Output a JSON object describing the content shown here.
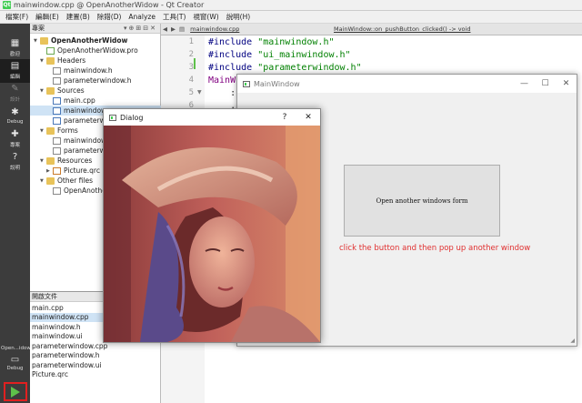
{
  "window": {
    "title": "mainwindow.cpp @ OpenAnotherWidow - Qt Creator"
  },
  "menu": [
    "檔案(F)",
    "編輯(E)",
    "建置(B)",
    "除錯(D)",
    "Analyze",
    "工具(T)",
    "視窗(W)",
    "說明(H)"
  ],
  "modes": [
    {
      "label": "歡迎",
      "icon": "grid-icon"
    },
    {
      "label": "編輯",
      "icon": "edit-icon"
    },
    {
      "label": "設計",
      "icon": "design-icon"
    },
    {
      "label": "Debug",
      "icon": "debug-icon"
    },
    {
      "label": "專案",
      "icon": "wrench-icon"
    },
    {
      "label": "說明",
      "icon": "help-icon"
    }
  ],
  "kit": {
    "name": "Open...idow",
    "mode": "Debug"
  },
  "project_panel": {
    "title": "專案",
    "tree": [
      {
        "label": "OpenAnotherWidow",
        "level": 0,
        "kind": "project"
      },
      {
        "label": "OpenAnotherWidow.pro",
        "level": 1,
        "kind": "proj"
      },
      {
        "label": "Headers",
        "level": 1,
        "kind": "folder"
      },
      {
        "label": "mainwindow.h",
        "level": 2,
        "kind": "file"
      },
      {
        "label": "parameterwindow.h",
        "level": 2,
        "kind": "file"
      },
      {
        "label": "Sources",
        "level": 1,
        "kind": "folder"
      },
      {
        "label": "main.cpp",
        "level": 2,
        "kind": "cpp"
      },
      {
        "label": "mainwindow.cpp",
        "level": 2,
        "kind": "cpp"
      },
      {
        "label": "parameterwindow.cpp",
        "level": 2,
        "kind": "cpp"
      },
      {
        "label": "Forms",
        "level": 1,
        "kind": "folder"
      },
      {
        "label": "mainwindow.ui",
        "level": 2,
        "kind": "file"
      },
      {
        "label": "parameterwindow.ui",
        "level": 2,
        "kind": "file"
      },
      {
        "label": "Resources",
        "level": 1,
        "kind": "folder"
      },
      {
        "label": "Picture.qrc",
        "level": 2,
        "kind": "res"
      },
      {
        "label": "Other files",
        "level": 1,
        "kind": "folder"
      },
      {
        "label": "OpenAnotherWidow",
        "level": 2,
        "kind": "file"
      }
    ]
  },
  "open_docs": {
    "title": "開啟文件",
    "items": [
      "main.cpp",
      "mainwindow.cpp",
      "mainwindow.h",
      "mainwindow.ui",
      "parameterwindow.cpp",
      "parameterwindow.h",
      "parameterwindow.ui",
      "Picture.qrc"
    ],
    "selected": "mainwindow.cpp"
  },
  "editor": {
    "file": "mainwindow.cpp",
    "function": "MainWindow::on_pushButton_clicked() -> void",
    "line_numbers": [
      "1",
      "2",
      "3",
      "4",
      "5",
      "6",
      "7"
    ]
  },
  "main_window": {
    "title": "MainWindow",
    "button_label": "Open another windows form",
    "hint": "click the button and then pop up another window"
  },
  "dialog": {
    "title": "Dialog",
    "help": "?"
  }
}
